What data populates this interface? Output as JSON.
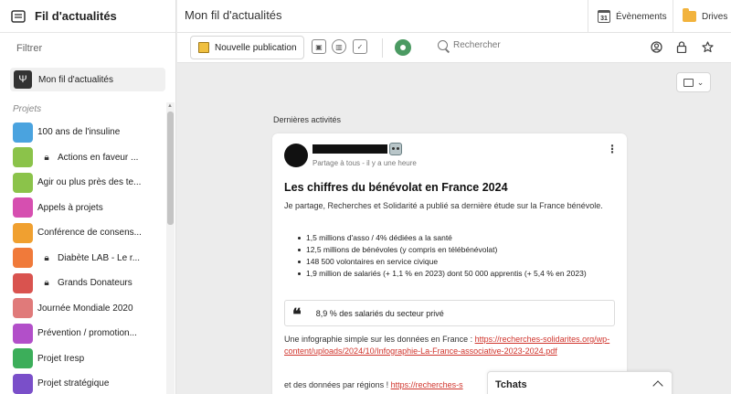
{
  "sidebar": {
    "title": "Fil d'actualités",
    "filter_label": "Filtrer",
    "feed_label": "Mon fil d'actualités",
    "projects_label": "Projets",
    "projects": [
      {
        "name": "100 ans de l'insuline",
        "locked": false,
        "color": "#4aa3df"
      },
      {
        "name": "Actions en faveur ...",
        "locked": true,
        "color": "#8bc34a"
      },
      {
        "name": "Agir ou plus près des te...",
        "locked": false,
        "color": "#8bc34a"
      },
      {
        "name": "Appels à projets",
        "locked": false,
        "color": "#d64fb0"
      },
      {
        "name": "Conférence de consens...",
        "locked": false,
        "color": "#f0a030"
      },
      {
        "name": "Diabète LAB - Le r...",
        "locked": true,
        "color": "#f07a3a"
      },
      {
        "name": "Grands Donateurs",
        "locked": true,
        "color": "#d9534f"
      },
      {
        "name": "Journée Mondiale 2020",
        "locked": false,
        "color": "#e07a7a"
      },
      {
        "name": "Prévention / promotion...",
        "locked": false,
        "color": "#b24fc9"
      },
      {
        "name": "Projet Iresp",
        "locked": false,
        "color": "#3cae5a"
      },
      {
        "name": "Projet stratégique",
        "locked": false,
        "color": "#7a4fc9"
      }
    ]
  },
  "topbar": {
    "page_title": "Mon fil d'actualités",
    "events_label": "Évènements",
    "calendar_day": "31",
    "drives_label": "Drives"
  },
  "toolbar": {
    "new_post_label": "Nouvelle publication",
    "search_placeholder": "Rechercher"
  },
  "section_label": "Dernières activités",
  "post": {
    "meta": "Partage à tous - il y a une heure",
    "title": "Les chiffres du bénévolat en France 2024",
    "intro": "Je partage, Recherches et Solidarité a publié sa dernière étude sur la France bénévole.",
    "bullets": [
      "1,5 millions d'asso / 4% dédiées a la santé",
      "12,5 millions de bénévoles (y compris en télébénévolat)",
      "148 500 volontaires en service civique",
      "1,9 million de salariés (+ 1,1 % en 2023) dont 50 000 apprentis (+ 5,4 % en 2023)"
    ],
    "quote_mark": "❝",
    "quote": "8,9 % des salariés du secteur privé",
    "para1_text": "Une infographie simple sur les données en France : ",
    "para1_link": "https://recherches-solidarites.org/wp-content/uploads/2024/10/Infographie-La-France-associative-2023-2024.pdf",
    "para2_text": "et des données par régions ! ",
    "para2_link": "https://recherches-s"
  },
  "chats": {
    "title": "Tchats"
  },
  "colors": {
    "link": "#d0342c",
    "eye": "#4b9a62",
    "folder": "#f2b33d"
  }
}
